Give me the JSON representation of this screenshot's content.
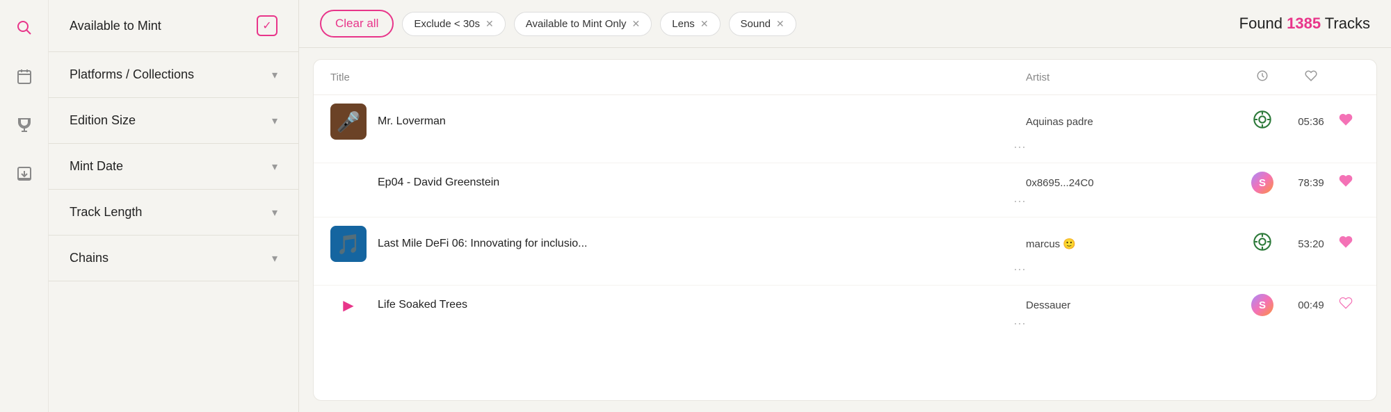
{
  "iconRail": {
    "icons": [
      {
        "name": "search-icon",
        "symbol": "🔍",
        "active": true
      },
      {
        "name": "calendar-icon",
        "symbol": "📅",
        "active": false
      },
      {
        "name": "trophy-icon",
        "symbol": "🏆",
        "active": false
      },
      {
        "name": "download-icon",
        "symbol": "📥",
        "active": false
      }
    ]
  },
  "sidebar": {
    "filters": [
      {
        "id": "available-to-mint",
        "label": "Available to Mint",
        "hasCheck": true,
        "hasChevron": false
      },
      {
        "id": "platforms-collections",
        "label": "Platforms / Collections",
        "hasCheck": false,
        "hasChevron": true
      },
      {
        "id": "edition-size",
        "label": "Edition Size",
        "hasCheck": false,
        "hasChevron": true
      },
      {
        "id": "mint-date",
        "label": "Mint Date",
        "hasCheck": false,
        "hasChevron": true
      },
      {
        "id": "track-length",
        "label": "Track Length",
        "hasCheck": false,
        "hasChevron": true
      },
      {
        "id": "chains",
        "label": "Chains",
        "hasCheck": false,
        "hasChevron": true
      }
    ]
  },
  "topBar": {
    "clearAllLabel": "Clear all",
    "tags": [
      {
        "id": "exclude-30s",
        "label": "Exclude < 30s"
      },
      {
        "id": "available-mint-only",
        "label": "Available to Mint Only"
      },
      {
        "id": "lens",
        "label": "Lens"
      },
      {
        "id": "sound",
        "label": "Sound"
      }
    ],
    "foundPrefix": "Found ",
    "foundCount": "1385",
    "foundSuffix": " Tracks"
  },
  "table": {
    "headers": {
      "title": "Title",
      "artist": "Artist",
      "clock": "⏱",
      "heart": "♡",
      "more": ""
    },
    "rows": [
      {
        "id": "row-1",
        "hasThumb": true,
        "thumbEmoji": "🎤",
        "thumbBg": "#8b5e3c",
        "title": "Mr. Loverman",
        "artist": "Aquinas padre",
        "platform": "lens",
        "duration": "05:36",
        "hasPlay": false
      },
      {
        "id": "row-2",
        "hasThumb": false,
        "thumbEmoji": "",
        "thumbBg": "",
        "title": "Ep04 - David Greenstein",
        "artist": "0x8695...24C0",
        "platform": "s-gradient",
        "duration": "78:39",
        "hasPlay": false
      },
      {
        "id": "row-3",
        "hasThumb": true,
        "thumbEmoji": "🎵",
        "thumbBg": "#1e7abf",
        "title": "Last Mile DeFi 06: Innovating for inclusio...",
        "artist": "marcus 🙂",
        "platform": "lens",
        "duration": "53:20",
        "hasPlay": false
      },
      {
        "id": "row-4",
        "hasThumb": false,
        "thumbEmoji": "",
        "thumbBg": "",
        "title": "Life Soaked Trees",
        "artist": "Dessauer",
        "platform": "s-gradient",
        "duration": "00:49",
        "hasPlay": true
      }
    ]
  }
}
